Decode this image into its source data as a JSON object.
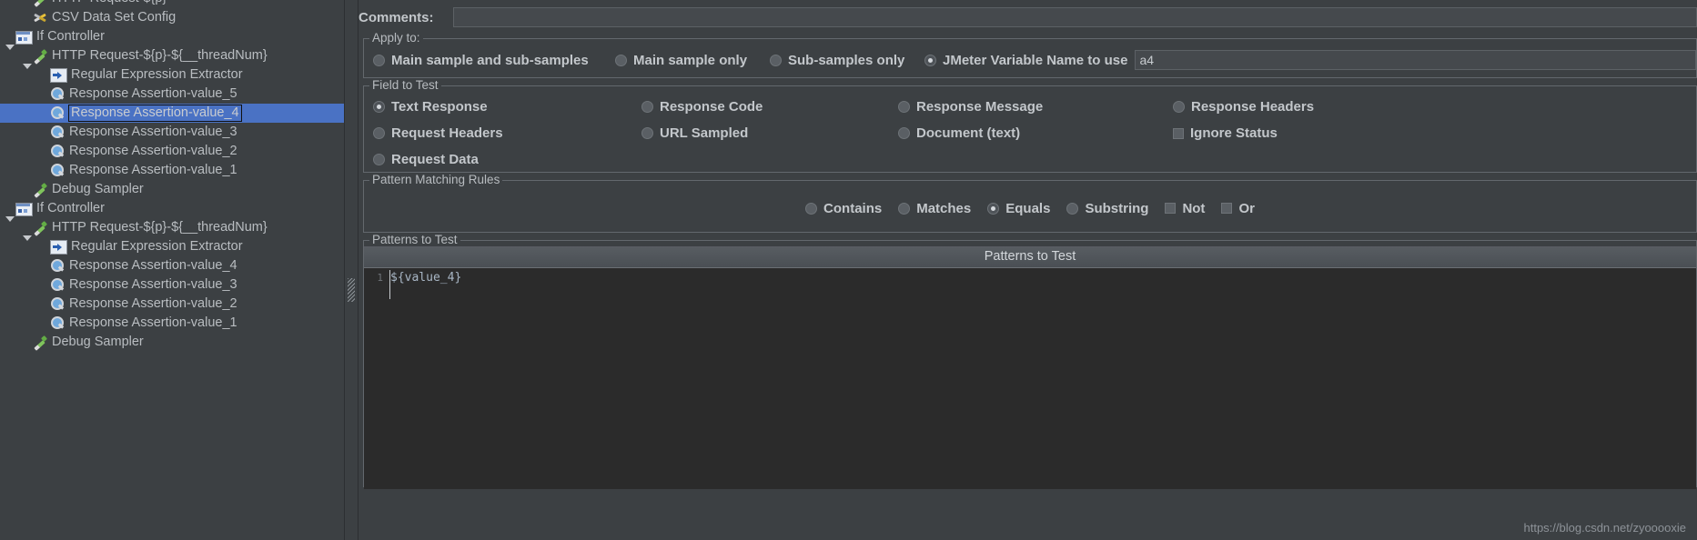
{
  "tree": {
    "items": [
      {
        "label": "HTTP Request-${p}",
        "icon": "http-sampler-icon",
        "indent": 1,
        "twisty": "none",
        "selected": false,
        "clipped": true
      },
      {
        "label": "CSV Data Set Config",
        "icon": "csv-config-icon",
        "indent": 1,
        "twisty": "none",
        "selected": false
      },
      {
        "label": "If Controller",
        "icon": "if-controller-icon",
        "indent": 0,
        "twisty": "open",
        "selected": false
      },
      {
        "label": "HTTP Request-${p}-${__threadNum}",
        "icon": "http-sampler-icon",
        "indent": 1,
        "twisty": "open",
        "selected": false
      },
      {
        "label": "Regular Expression Extractor",
        "icon": "regex-extractor-icon",
        "indent": 2,
        "twisty": "none",
        "selected": false
      },
      {
        "label": "Response Assertion-value_5",
        "icon": "response-assertion-icon",
        "indent": 2,
        "twisty": "none",
        "selected": false
      },
      {
        "label": "Response Assertion-value_4",
        "icon": "response-assertion-icon",
        "indent": 2,
        "twisty": "none",
        "selected": true
      },
      {
        "label": "Response Assertion-value_3",
        "icon": "response-assertion-icon",
        "indent": 2,
        "twisty": "none",
        "selected": false
      },
      {
        "label": "Response Assertion-value_2",
        "icon": "response-assertion-icon",
        "indent": 2,
        "twisty": "none",
        "selected": false
      },
      {
        "label": "Response Assertion-value_1",
        "icon": "response-assertion-icon",
        "indent": 2,
        "twisty": "none",
        "selected": false
      },
      {
        "label": "Debug Sampler",
        "icon": "http-sampler-icon",
        "indent": 1,
        "twisty": "none",
        "selected": false
      },
      {
        "label": "If Controller",
        "icon": "if-controller-icon",
        "indent": 0,
        "twisty": "open",
        "selected": false
      },
      {
        "label": "HTTP Request-${p}-${__threadNum}",
        "icon": "http-sampler-icon",
        "indent": 1,
        "twisty": "open",
        "selected": false
      },
      {
        "label": "Regular Expression Extractor",
        "icon": "regex-extractor-icon",
        "indent": 2,
        "twisty": "none",
        "selected": false
      },
      {
        "label": "Response Assertion-value_4",
        "icon": "response-assertion-icon",
        "indent": 2,
        "twisty": "none",
        "selected": false
      },
      {
        "label": "Response Assertion-value_3",
        "icon": "response-assertion-icon",
        "indent": 2,
        "twisty": "none",
        "selected": false
      },
      {
        "label": "Response Assertion-value_2",
        "icon": "response-assertion-icon",
        "indent": 2,
        "twisty": "none",
        "selected": false
      },
      {
        "label": "Response Assertion-value_1",
        "icon": "response-assertion-icon",
        "indent": 2,
        "twisty": "none",
        "selected": false
      },
      {
        "label": "Debug Sampler",
        "icon": "http-sampler-icon",
        "indent": 1,
        "twisty": "none",
        "selected": false
      }
    ]
  },
  "comments": {
    "label": "Comments:",
    "value": "",
    "placeholder": ""
  },
  "apply_to": {
    "title": "Apply to:",
    "options": [
      {
        "label": "Main sample and sub-samples",
        "checked": false
      },
      {
        "label": "Main sample only",
        "checked": false
      },
      {
        "label": "Sub-samples only",
        "checked": false
      },
      {
        "label": "JMeter Variable Name to use",
        "checked": true
      }
    ],
    "variable_value": "a4",
    "variable_placeholder": ""
  },
  "field_to_test": {
    "title": "Field to Test",
    "options": [
      {
        "label": "Text Response",
        "checked": true,
        "type": "radio"
      },
      {
        "label": "Response Code",
        "checked": false,
        "type": "radio"
      },
      {
        "label": "Response Message",
        "checked": false,
        "type": "radio"
      },
      {
        "label": "Response Headers",
        "checked": false,
        "type": "radio"
      },
      {
        "label": "Request Headers",
        "checked": false,
        "type": "radio"
      },
      {
        "label": "URL Sampled",
        "checked": false,
        "type": "radio"
      },
      {
        "label": "Document (text)",
        "checked": false,
        "type": "radio"
      },
      {
        "label": "Ignore Status",
        "checked": false,
        "type": "checkbox"
      },
      {
        "label": "Request Data",
        "checked": false,
        "type": "radio"
      }
    ]
  },
  "pattern_matching_rules": {
    "title": "Pattern Matching Rules",
    "options": [
      {
        "label": "Contains",
        "checked": false,
        "type": "radio"
      },
      {
        "label": "Matches",
        "checked": false,
        "type": "radio"
      },
      {
        "label": "Equals",
        "checked": true,
        "type": "radio"
      },
      {
        "label": "Substring",
        "checked": false,
        "type": "radio"
      },
      {
        "label": "Not",
        "checked": false,
        "type": "checkbox"
      },
      {
        "label": "Or",
        "checked": false,
        "type": "checkbox"
      }
    ]
  },
  "patterns_to_test": {
    "title": "Patterns to Test",
    "column_header": "Patterns to Test",
    "lines": [
      {
        "number": "1",
        "text": "${value_4}"
      }
    ]
  },
  "watermark": {
    "text": "https://blog.csdn.net/zyooooxie"
  },
  "colors": {
    "background": "#3c4043",
    "selection": "#4a72c4",
    "text": "#c3c7cb",
    "editor_background": "#2b2b2b",
    "editor_text": "#a9b7c6"
  }
}
